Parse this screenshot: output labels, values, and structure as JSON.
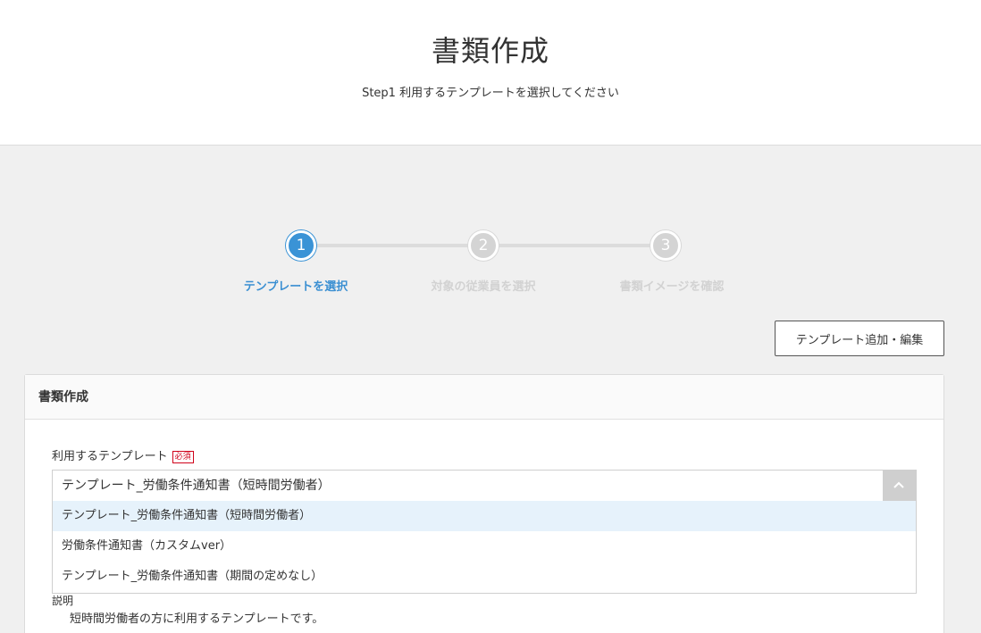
{
  "header": {
    "title": "書類作成",
    "subtitle": "Step1 利用するテンプレートを選択してください"
  },
  "stepper": {
    "steps": [
      {
        "number": "1",
        "label": "テンプレートを選択",
        "active": true
      },
      {
        "number": "2",
        "label": "対象の従業員を選択",
        "active": false
      },
      {
        "number": "3",
        "label": "書類イメージを確認",
        "active": false
      }
    ]
  },
  "toolbar": {
    "add_edit_label": "テンプレート追加・編集"
  },
  "card": {
    "title": "書類作成",
    "template_field": {
      "label": "利用するテンプレート",
      "required": "必須",
      "selected": "テンプレート_労働条件通知書（短時間労働者）",
      "options": [
        "テンプレート_労働条件通知書（短時間労働者）",
        "労働条件通知書（カスタムver）",
        "テンプレート_労働条件通知書（期間の定めなし）"
      ]
    },
    "description_label": "説明",
    "description": "短時間労働者の方に利用するテンプレートです。"
  },
  "colors": {
    "accent": "#3a93d6",
    "inactive": "#d4d4d4",
    "required": "#d0021b",
    "highlight": "#e6f2fb"
  }
}
